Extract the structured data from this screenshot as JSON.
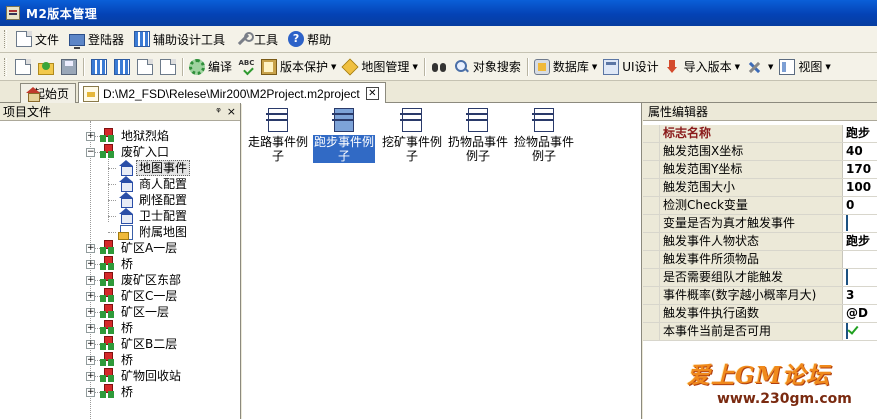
{
  "window": {
    "title": "M2版本管理"
  },
  "menu": {
    "items": [
      {
        "label": "文件",
        "icon": "new-document-icon"
      },
      {
        "label": "登陆器",
        "icon": "monitor-icon"
      },
      {
        "label": "辅助设计工具",
        "icon": "grid-icon"
      },
      {
        "label": "工具",
        "icon": "wrench-icon"
      },
      {
        "label": "帮助",
        "icon": "help-icon"
      }
    ]
  },
  "toolbar": {
    "compile": "编译",
    "version_protect": "版本保护",
    "map_manage": "地图管理",
    "object_search": "对象搜索",
    "database": "数据库",
    "ui_design": "UI设计",
    "import_version": "导入版本",
    "view": "视图"
  },
  "tabs": [
    {
      "label": "起始页",
      "icon": "house-icon",
      "active": false
    },
    {
      "label": "D:\\M2_FSD\\Relese\\Mir200\\M2Project.m2project",
      "icon": "project-file-icon",
      "active": true
    }
  ],
  "project_pane": {
    "title": "项目文件",
    "pin_glyph": "ᵠ",
    "close_glyph": "×",
    "tree": [
      {
        "label": "地狱烈焰",
        "expander": "+",
        "level": 0
      },
      {
        "label": "废矿入口",
        "expander": "-",
        "level": 0
      },
      {
        "label": "地图事件",
        "level": 1,
        "selected": true
      },
      {
        "label": "商人配置",
        "level": 1
      },
      {
        "label": "刷怪配置",
        "level": 1
      },
      {
        "label": "卫士配置",
        "level": 1
      },
      {
        "label": "附属地图",
        "level": 1
      },
      {
        "label": "矿区A一层",
        "expander": "+",
        "level": 0
      },
      {
        "label": "桥",
        "expander": "+",
        "level": 0
      },
      {
        "label": "废矿区东部",
        "expander": "+",
        "level": 0
      },
      {
        "label": "矿区C一层",
        "expander": "+",
        "level": 0
      },
      {
        "label": "矿区一层",
        "expander": "+",
        "level": 0
      },
      {
        "label": "桥",
        "expander": "+",
        "level": 0
      },
      {
        "label": "矿区B二层",
        "expander": "+",
        "level": 0
      },
      {
        "label": "桥",
        "expander": "+",
        "level": 0
      },
      {
        "label": "矿物回收站",
        "expander": "+",
        "level": 0
      },
      {
        "label": "桥",
        "expander": "+",
        "level": 0
      }
    ]
  },
  "events": [
    {
      "line1": "走路事件例",
      "line2": "子",
      "selected": false
    },
    {
      "line1": "跑步事件例",
      "line2": "子",
      "selected": true
    },
    {
      "line1": "挖矿事件例",
      "line2": "子",
      "selected": false
    },
    {
      "line1": "扔物品事件",
      "line2": "例子",
      "selected": false
    },
    {
      "line1": "捡物品事件",
      "line2": "例子",
      "selected": false
    }
  ],
  "properties": {
    "title": "属性编辑器",
    "rows": [
      {
        "name": "标志名称",
        "value": "跑步",
        "header": true
      },
      {
        "name": "触发范围X坐标",
        "value": "40"
      },
      {
        "name": "触发范围Y坐标",
        "value": "170"
      },
      {
        "name": "触发范围大小",
        "value": "100"
      },
      {
        "name": "检测Check变量",
        "value": "0"
      },
      {
        "name": "变量是否为真才触发事件",
        "check": false
      },
      {
        "name": "触发事件人物状态",
        "value": "跑步"
      },
      {
        "name": "触发事件所须物品",
        "value": ""
      },
      {
        "name": "是否需要组队才能触发",
        "check": false
      },
      {
        "name": "事件概率(数字越小概率月大)",
        "value": "3"
      },
      {
        "name": "触发事件执行函数",
        "value": "@D"
      },
      {
        "name": "本事件当前是否可用",
        "check": true
      }
    ]
  },
  "watermark": {
    "text": "爱上GM论坛",
    "url": "www.230gm.com"
  }
}
